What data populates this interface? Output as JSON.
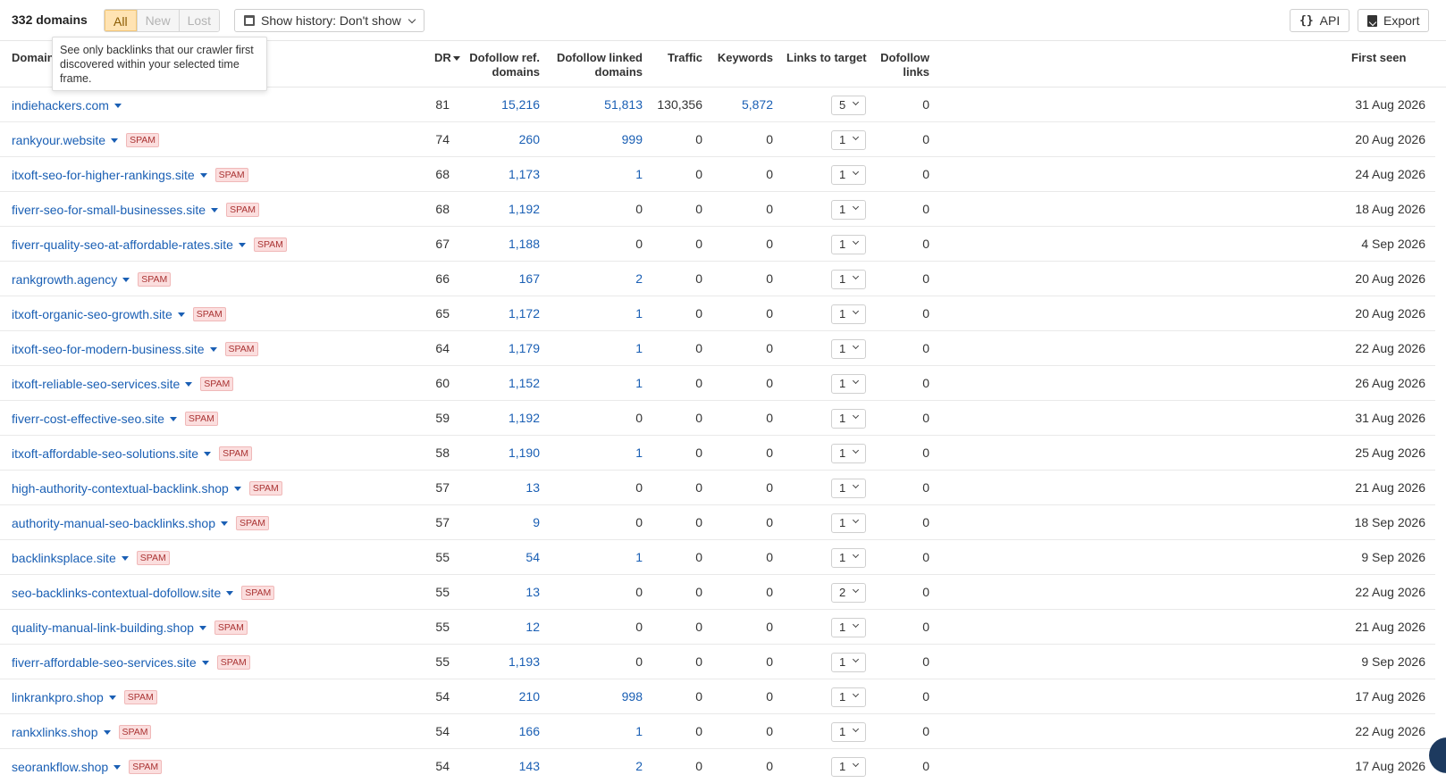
{
  "toolbar": {
    "domain_count": "332 domains",
    "filter_tabs": [
      "All",
      "New",
      "Lost"
    ],
    "active_tab": "All",
    "history_label": "Show history: Don't show",
    "api_label": "API",
    "export_label": "Export"
  },
  "tooltip": {
    "text": "See only backlinks that our crawler first discovered within your selected time frame."
  },
  "columns": {
    "domain": "Domain",
    "dr": "DR",
    "dofollow_ref_domains": "Dofollow ref. domains",
    "dofollow_linked_domains": "Dofollow linked domains",
    "traffic": "Traffic",
    "keywords": "Keywords",
    "links_to_target": "Links to target",
    "dofollow_links": "Dofollow links",
    "first_seen": "First seen"
  },
  "spam_label": "SPAM",
  "rows": [
    {
      "domain": "indiehackers.com",
      "spam": false,
      "dr": "81",
      "ref": "15,216",
      "linked": "51,813",
      "traffic": "130,356",
      "keywords": "5,872",
      "ltt": "5",
      "dofollow": "0",
      "first_seen": "31 Aug 2026"
    },
    {
      "domain": "rankyour.website",
      "spam": true,
      "dr": "74",
      "ref": "260",
      "linked": "999",
      "traffic": "0",
      "keywords": "0",
      "ltt": "1",
      "dofollow": "0",
      "first_seen": "20 Aug 2026"
    },
    {
      "domain": "itxoft-seo-for-higher-rankings.site",
      "spam": true,
      "dr": "68",
      "ref": "1,173",
      "linked": "1",
      "traffic": "0",
      "keywords": "0",
      "ltt": "1",
      "dofollow": "0",
      "first_seen": "24 Aug 2026"
    },
    {
      "domain": "fiverr-seo-for-small-businesses.site",
      "spam": true,
      "dr": "68",
      "ref": "1,192",
      "linked": "0",
      "traffic": "0",
      "keywords": "0",
      "ltt": "1",
      "dofollow": "0",
      "first_seen": "18 Aug 2026"
    },
    {
      "domain": "fiverr-quality-seo-at-affordable-rates.site",
      "spam": true,
      "dr": "67",
      "ref": "1,188",
      "linked": "0",
      "traffic": "0",
      "keywords": "0",
      "ltt": "1",
      "dofollow": "0",
      "first_seen": "4 Sep 2026"
    },
    {
      "domain": "rankgrowth.agency",
      "spam": true,
      "dr": "66",
      "ref": "167",
      "linked": "2",
      "traffic": "0",
      "keywords": "0",
      "ltt": "1",
      "dofollow": "0",
      "first_seen": "20 Aug 2026"
    },
    {
      "domain": "itxoft-organic-seo-growth.site",
      "spam": true,
      "dr": "65",
      "ref": "1,172",
      "linked": "1",
      "traffic": "0",
      "keywords": "0",
      "ltt": "1",
      "dofollow": "0",
      "first_seen": "20 Aug 2026"
    },
    {
      "domain": "itxoft-seo-for-modern-business.site",
      "spam": true,
      "dr": "64",
      "ref": "1,179",
      "linked": "1",
      "traffic": "0",
      "keywords": "0",
      "ltt": "1",
      "dofollow": "0",
      "first_seen": "22 Aug 2026"
    },
    {
      "domain": "itxoft-reliable-seo-services.site",
      "spam": true,
      "dr": "60",
      "ref": "1,152",
      "linked": "1",
      "traffic": "0",
      "keywords": "0",
      "ltt": "1",
      "dofollow": "0",
      "first_seen": "26 Aug 2026"
    },
    {
      "domain": "fiverr-cost-effective-seo.site",
      "spam": true,
      "dr": "59",
      "ref": "1,192",
      "linked": "0",
      "traffic": "0",
      "keywords": "0",
      "ltt": "1",
      "dofollow": "0",
      "first_seen": "31 Aug 2026"
    },
    {
      "domain": "itxoft-affordable-seo-solutions.site",
      "spam": true,
      "dr": "58",
      "ref": "1,190",
      "linked": "1",
      "traffic": "0",
      "keywords": "0",
      "ltt": "1",
      "dofollow": "0",
      "first_seen": "25 Aug 2026"
    },
    {
      "domain": "high-authority-contextual-backlink.shop",
      "spam": true,
      "dr": "57",
      "ref": "13",
      "linked": "0",
      "traffic": "0",
      "keywords": "0",
      "ltt": "1",
      "dofollow": "0",
      "first_seen": "21 Aug 2026"
    },
    {
      "domain": "authority-manual-seo-backlinks.shop",
      "spam": true,
      "dr": "57",
      "ref": "9",
      "linked": "0",
      "traffic": "0",
      "keywords": "0",
      "ltt": "1",
      "dofollow": "0",
      "first_seen": "18 Sep 2026"
    },
    {
      "domain": "backlinksplace.site",
      "spam": true,
      "dr": "55",
      "ref": "54",
      "linked": "1",
      "traffic": "0",
      "keywords": "0",
      "ltt": "1",
      "dofollow": "0",
      "first_seen": "9 Sep 2026"
    },
    {
      "domain": "seo-backlinks-contextual-dofollow.site",
      "spam": true,
      "dr": "55",
      "ref": "13",
      "linked": "0",
      "traffic": "0",
      "keywords": "0",
      "ltt": "2",
      "dofollow": "0",
      "first_seen": "22 Aug 2026"
    },
    {
      "domain": "quality-manual-link-building.shop",
      "spam": true,
      "dr": "55",
      "ref": "12",
      "linked": "0",
      "traffic": "0",
      "keywords": "0",
      "ltt": "1",
      "dofollow": "0",
      "first_seen": "21 Aug 2026"
    },
    {
      "domain": "fiverr-affordable-seo-services.site",
      "spam": true,
      "dr": "55",
      "ref": "1,193",
      "linked": "0",
      "traffic": "0",
      "keywords": "0",
      "ltt": "1",
      "dofollow": "0",
      "first_seen": "9 Sep 2026"
    },
    {
      "domain": "linkrankpro.shop",
      "spam": true,
      "dr": "54",
      "ref": "210",
      "linked": "998",
      "traffic": "0",
      "keywords": "0",
      "ltt": "1",
      "dofollow": "0",
      "first_seen": "17 Aug 2026"
    },
    {
      "domain": "rankxlinks.shop",
      "spam": true,
      "dr": "54",
      "ref": "166",
      "linked": "1",
      "traffic": "0",
      "keywords": "0",
      "ltt": "1",
      "dofollow": "0",
      "first_seen": "22 Aug 2026"
    },
    {
      "domain": "seorankflow.shop",
      "spam": true,
      "dr": "54",
      "ref": "143",
      "linked": "2",
      "traffic": "0",
      "keywords": "0",
      "ltt": "1",
      "dofollow": "0",
      "first_seen": "17 Aug 2026"
    }
  ]
}
